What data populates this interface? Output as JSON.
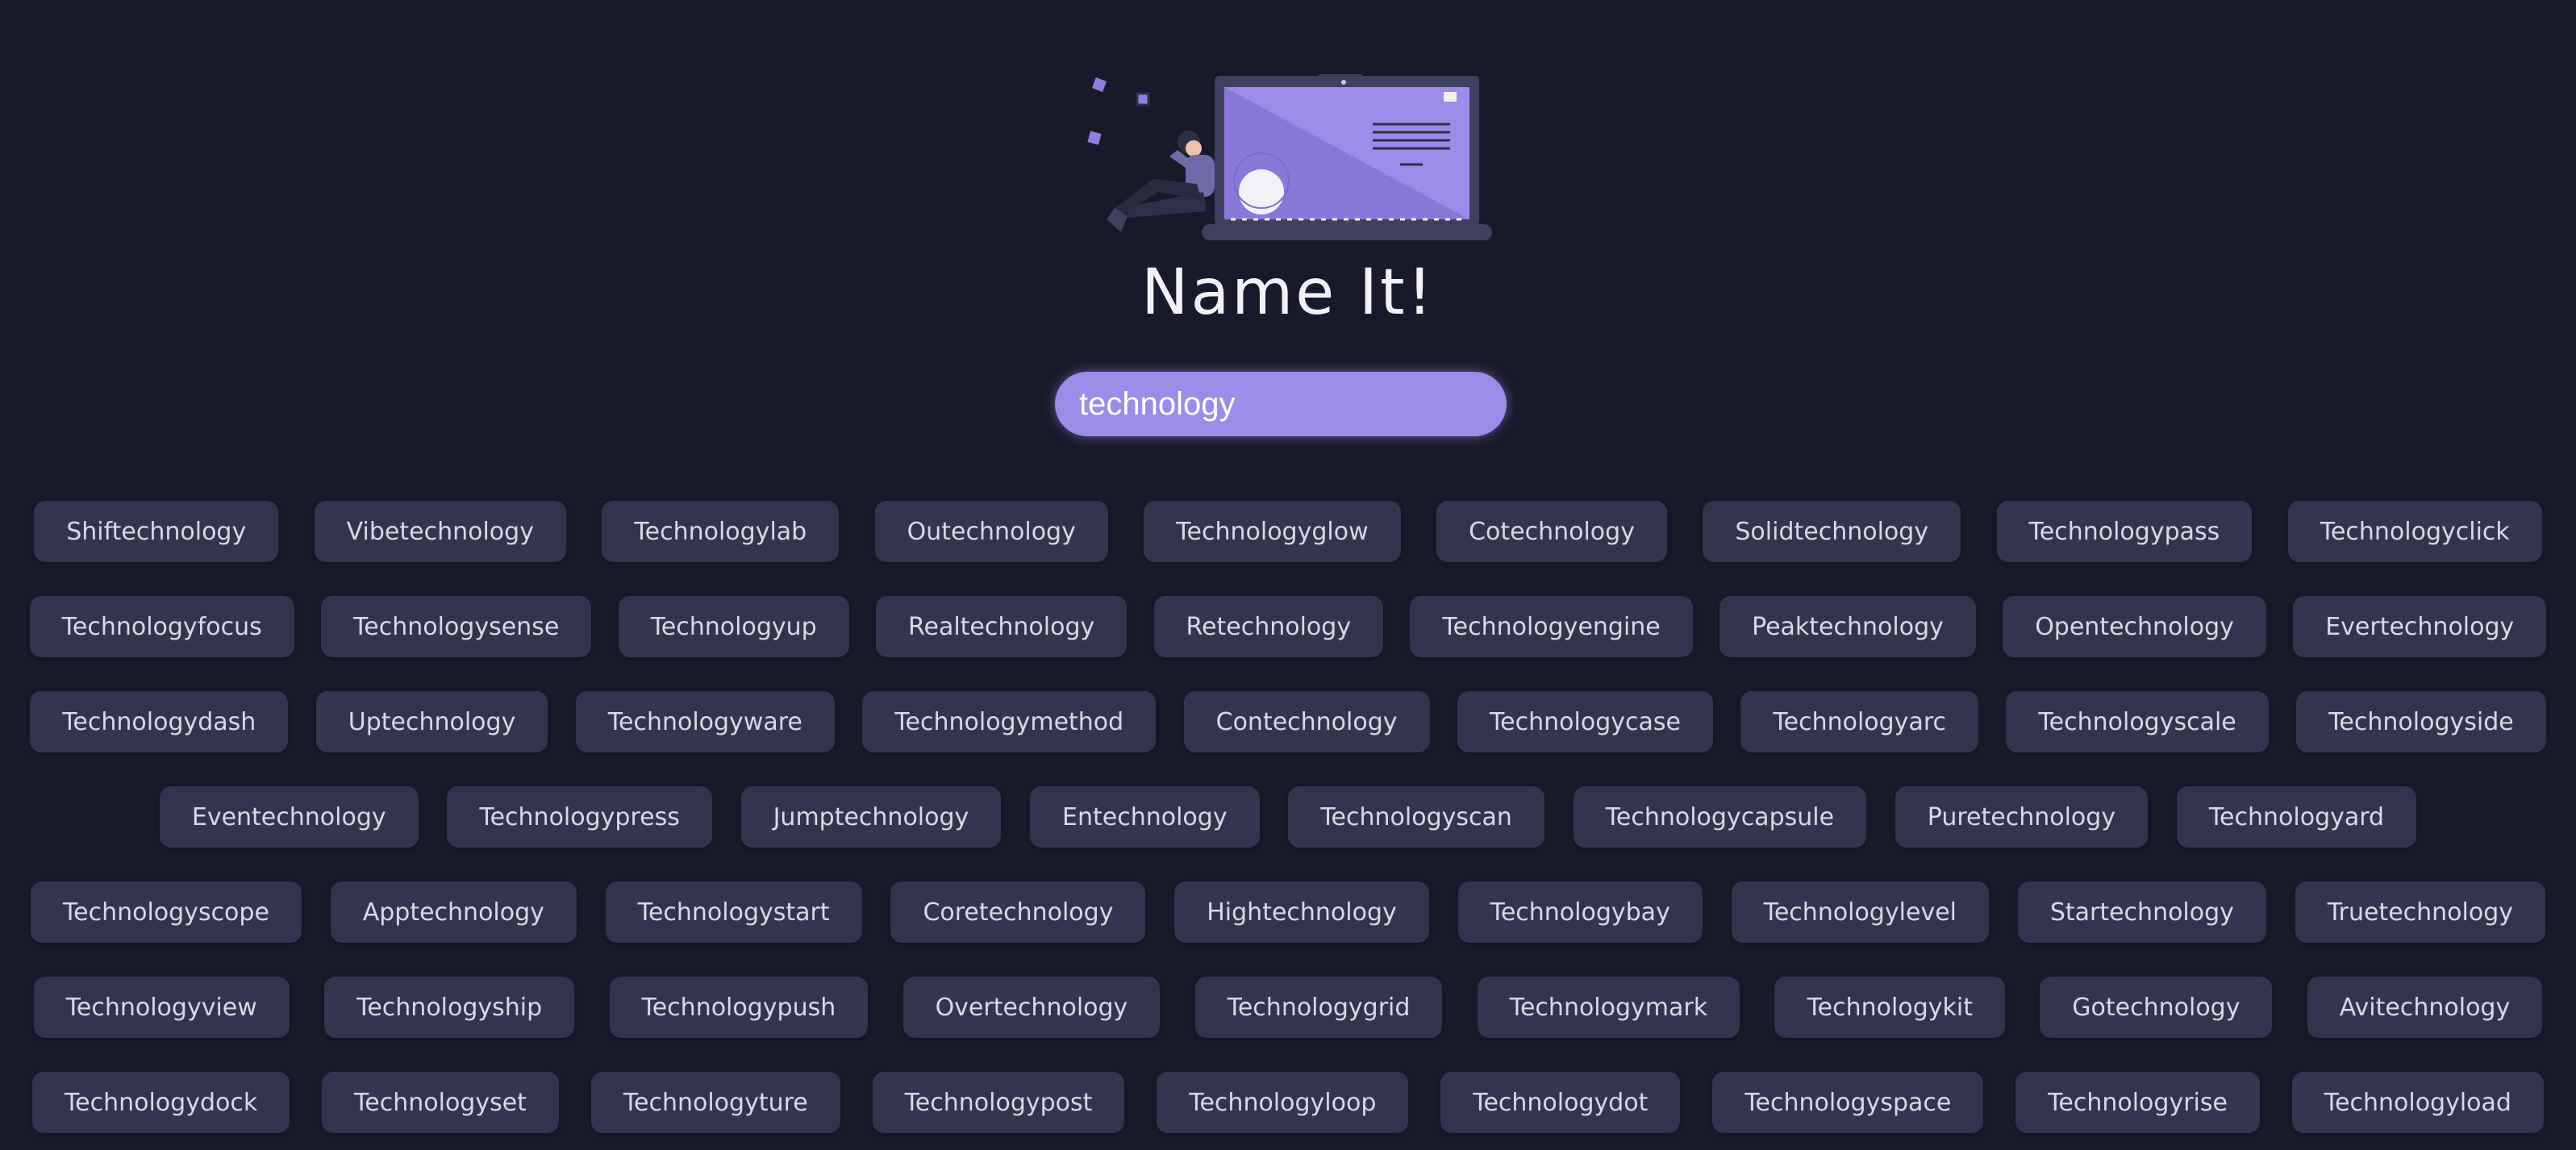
{
  "header": {
    "title": "Name It!"
  },
  "search": {
    "value": "technology"
  },
  "colors": {
    "background": "#181a2b",
    "accent": "#9d8be8",
    "chip": "#33344f"
  },
  "illustration": {
    "icon": "person-with-laptop-illustration"
  },
  "rows": [
    [
      "Shiftechnology",
      "Vibetechnology",
      "Technologylab",
      "Outechnology",
      "Technologyglow",
      "Cotechnology",
      "Solidtechnology",
      "Technologypass",
      "Technologyclick"
    ],
    [
      "Technologyfocus",
      "Technologysense",
      "Technologyup",
      "Realtechnology",
      "Retechnology",
      "Technologyengine",
      "Peaktechnology",
      "Opentechnology",
      "Evertechnology"
    ],
    [
      "Technologydash",
      "Uptechnology",
      "Technologyware",
      "Technologymethod",
      "Contechnology",
      "Technologycase",
      "Technologyarc",
      "Technologyscale",
      "Technologyside"
    ],
    [
      "Eventechnology",
      "Technologypress",
      "Jumptechnology",
      "Entechnology",
      "Technologyscan",
      "Technologycapsule",
      "Puretechnology",
      "Technologyard"
    ],
    [
      "Technologyscope",
      "Apptechnology",
      "Technologystart",
      "Coretechnology",
      "Hightechnology",
      "Technologybay",
      "Technologylevel",
      "Startechnology",
      "Truetechnology"
    ],
    [
      "Technologyview",
      "Technologyship",
      "Technologypush",
      "Overtechnology",
      "Technologygrid",
      "Technologymark",
      "Technologykit",
      "Gotechnology",
      "Avitechnology"
    ],
    [
      "Technologydock",
      "Technologyset",
      "Technologyture",
      "Technologypost",
      "Technologyloop",
      "Technologydot",
      "Technologyspace",
      "Technologyrise",
      "Technologyload"
    ]
  ]
}
